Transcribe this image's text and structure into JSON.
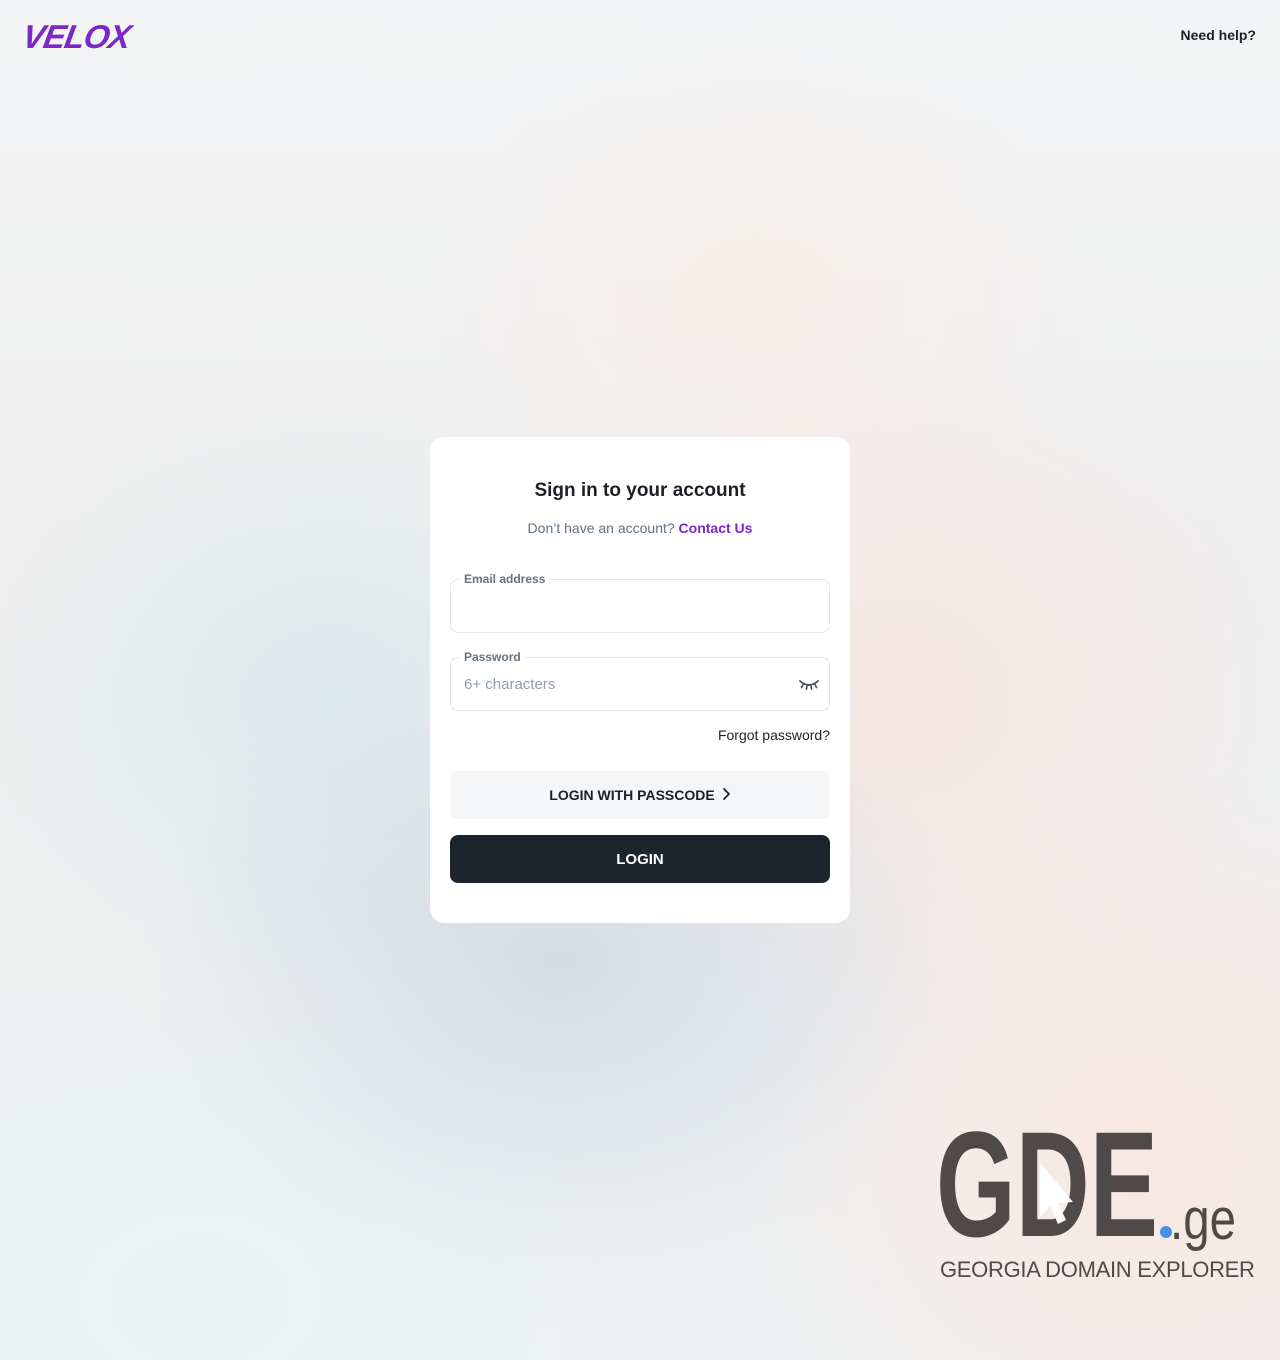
{
  "header": {
    "logo_text": "VELOX",
    "help_label": "Need help?"
  },
  "login_card": {
    "title": "Sign in to your account",
    "subtitle_prefix": "Don’t have an account?",
    "contact_link": "Contact Us",
    "email_label": "Email address",
    "email_value": "",
    "password_label": "Password",
    "password_placeholder": "6+ characters",
    "forgot_password": "Forgot password?",
    "passcode_button": "LOGIN WITH PASSCODE",
    "login_button": "LOGIN"
  },
  "footer_logo": {
    "wordmark": "GDE",
    "domain_suffix": ".ge",
    "tagline": "GEORGIA DOMAIN EXPLORER"
  },
  "colors": {
    "brand_purple": "#7a28c9",
    "login_button_bg": "#1c252e",
    "gde_gray": "#4f4a48",
    "gde_dot_blue": "#4a90e2"
  },
  "icons": {
    "password_toggle": "eye-closed-icon",
    "passcode_arrow": "chevron-right-icon"
  }
}
